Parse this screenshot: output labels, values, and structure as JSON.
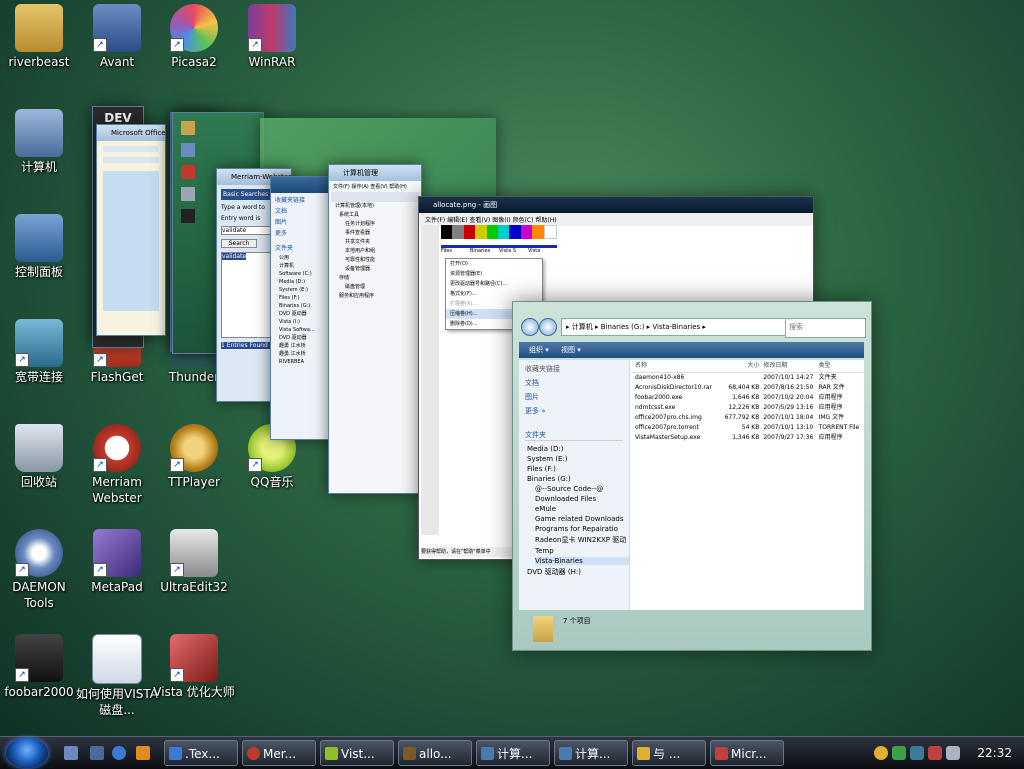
{
  "desktop_icons": [
    {
      "label": "riverbeast",
      "icon": "folder-icon",
      "color": "#c9a24a"
    },
    {
      "label": "Avant",
      "icon": "avant-browser-icon",
      "color": "#3a5e9a"
    },
    {
      "label": "Picasa2",
      "icon": "picasa-icon",
      "color": "#cc4466"
    },
    {
      "label": "WinRAR",
      "icon": "winrar-icon",
      "color": "#7a3f9a"
    },
    {
      "label": "计算机",
      "icon": "computer-icon",
      "color": "#6a8cc0"
    },
    {
      "label": "控制面板",
      "icon": "control-panel-icon",
      "color": "#4a7ab0"
    },
    {
      "label": "宽带连接",
      "icon": "network-icon",
      "color": "#3e7a9a"
    },
    {
      "label": "FlashGet",
      "icon": "flashget-icon",
      "color": "#c23a2a"
    },
    {
      "label": "Thunder",
      "icon": "thunder-icon",
      "color": "#3366aa"
    },
    {
      "label": "回收站",
      "icon": "recycle-bin-icon",
      "color": "#9aa7b3"
    },
    {
      "label": "Merriam Webster",
      "icon": "merriam-webster-icon",
      "color": "#c0392b"
    },
    {
      "label": "TTPlayer",
      "icon": "ttplayer-icon",
      "color": "#b8841c"
    },
    {
      "label": "QQ音乐",
      "icon": "qq-music-icon",
      "color": "#8fbf2a"
    },
    {
      "label": "DAEMON Tools",
      "icon": "daemon-tools-icon",
      "color": "#1f3f7a"
    },
    {
      "label": "MetaPad",
      "icon": "metapad-icon",
      "color": "#5a3d9a"
    },
    {
      "label": "UltraEdit32",
      "icon": "ultraedit-icon",
      "color": "#d4b03a"
    },
    {
      "label": "foobar2000",
      "icon": "foobar-icon",
      "color": "#222222"
    },
    {
      "label": "如何使用VISTA磁盘...",
      "icon": "word-document-icon",
      "color": "#2a5caa"
    },
    {
      "label": "Vista 优化大师",
      "icon": "vista-optimizer-icon",
      "color": "#b03030"
    }
  ],
  "flip3d": {
    "small1_title": "Merriam-Webster's 11th Collegiate Dic...",
    "webster_search_label": "Basic Searches",
    "webster_input_hint": "Type a word to",
    "webster_entry": "Entry word is",
    "webster_value": "validate",
    "webster_search_btn": "Search",
    "webster_result": "validate",
    "webster_status": "1 Entries Found",
    "compmgmt_title": "计算机管理",
    "compmgmt_menu": [
      "文件(F)",
      "操作(A)",
      "查看(V)",
      "帮助(H)"
    ],
    "compmgmt_tree": [
      "计算机管理(本地)",
      "系统工具",
      "任务计划程序",
      "事件查看器",
      "共享文件夹",
      "本地用户和组",
      "可靠性和性能",
      "设备管理器",
      "存储",
      "磁盘管理",
      "服务和应用程序"
    ],
    "explorer_small_items": [
      "公用",
      "计算机",
      "Software (C:)",
      "Media (D:)",
      "System (E:)",
      "Files (F:)",
      "Binaries (G:)",
      "DVD 驱动器",
      "Vista (I:)",
      "Vista Softwa...",
      "DVD 驱动器",
      "趣勇 江水桥",
      "趣勇 江水桥",
      "RIVERBEA"
    ],
    "explorer_small_links": [
      "收藏夹链接",
      "文档",
      "图片",
      "更多",
      "文件夹"
    ],
    "paint_title": "allocate.png - 画图",
    "paint_menu": [
      "文件(F)",
      "编辑(E)",
      "查看(V)",
      "图像(I)",
      "颜色(C)",
      "帮助(H)"
    ],
    "paint_context": [
      "打开(O)",
      "资源管理器(E)",
      "更改驱动器号和路径(C)...",
      "格式化(F)...",
      "扩展卷(X)...",
      "压缩卷(H)...",
      "删除卷(D)..."
    ],
    "paint_disks": [
      "Files",
      "Binaries",
      "Vista S",
      "Vista"
    ],
    "paint_status": "要获得帮助，请在\"帮助\"菜单中"
  },
  "explorer": {
    "breadcrumb": "▸ 计算机 ▸ Binaries (G:) ▸ Vista-Binaries ▸",
    "search_placeholder": "搜索",
    "organize": "组织 ▾",
    "views": "视图 ▾",
    "fav_links": [
      "收藏夹链接",
      "文档",
      "图片",
      "更多 »"
    ],
    "folders_label": "文件夹",
    "tree": [
      "Media (D:)",
      "System (E:)",
      "Files (F:)",
      "Binaries (G:)",
      "@--Source Code--@",
      "Downloaded Files",
      "eMule",
      "Game related Downloads",
      "Programs for Repairatio",
      "Radeon显卡 WIN2KXP 驱动",
      "Temp",
      "Vista-Binaries",
      "DVD 驱动器 (H:)"
    ],
    "columns": [
      "名称",
      "大小",
      "修改日期",
      "类型"
    ],
    "files": [
      {
        "name": "daemon410-x86",
        "size": "",
        "date": "2007/10/1 14:27",
        "type": "文件夹"
      },
      {
        "name": "AcronisDiskDirector10.rar",
        "size": "68,404 KB",
        "date": "2007/8/16 21:50",
        "type": "RAR 文件"
      },
      {
        "name": "foobar2000.exe",
        "size": "1,646 KB",
        "date": "2007/10/2 20:04",
        "type": "应用程序"
      },
      {
        "name": "ndmtcsst.exe",
        "size": "12,226 KB",
        "date": "2007/5/29 13:16",
        "type": "应用程序"
      },
      {
        "name": "office2007pro.chs.img",
        "size": "677,792 KB",
        "date": "2007/10/1 18:04",
        "type": "IMG 文件"
      },
      {
        "name": "office2007pro.torrent",
        "size": "54 KB",
        "date": "2007/10/1 13:10",
        "type": "TORRENT File"
      },
      {
        "name": "VistaMasterSetup.exe",
        "size": "1,346 KB",
        "date": "2007/9/27 17:36",
        "type": "应用程序"
      }
    ],
    "item_count": "7 个项目"
  },
  "taskbar": {
    "tasks": [
      {
        "label": ".Tex...",
        "color": "#3b7bd4",
        "icon": "ie-icon"
      },
      {
        "label": "Mer...",
        "color": "#c0392b",
        "icon": "merriam-webster-icon"
      },
      {
        "label": "Vist...",
        "color": "#8fbf2a",
        "icon": "vista-optimizer-icon"
      },
      {
        "label": "allo...",
        "color": "#7a5a2a",
        "icon": "paint-icon"
      },
      {
        "label": "计算...",
        "color": "#4a7ab0",
        "icon": "computer-icon"
      },
      {
        "label": "计算...",
        "color": "#4a7ab0",
        "icon": "computer-management-icon"
      },
      {
        "label": "与 ...",
        "color": "#e0b030",
        "icon": "chat-icon"
      },
      {
        "label": "Micr...",
        "color": "#c04040",
        "icon": "microsoft-picture-icon"
      }
    ],
    "clock": "22:32"
  }
}
